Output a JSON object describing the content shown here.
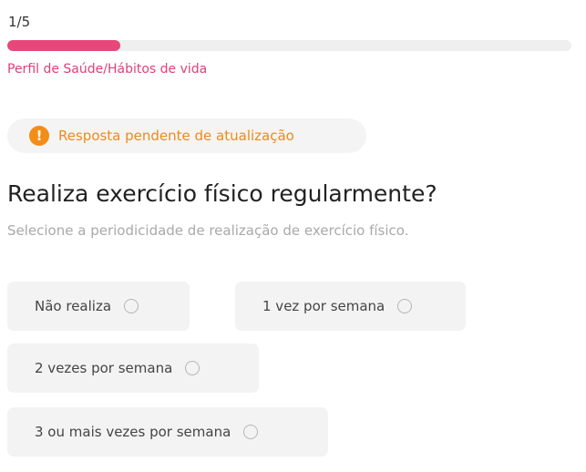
{
  "progress": {
    "counter": "1/5",
    "fraction": 0.2,
    "section": "Perfil de Saúde/Hábitos de vida",
    "fill_color": "#e7477a"
  },
  "status": {
    "icon": "warning-icon",
    "icon_glyph": "!",
    "text": "Resposta pendente de atualização",
    "color": "#ef8a17"
  },
  "question": {
    "title": "Realiza exercício físico regularmente?",
    "hint": "Selecione a periodicidade de realização de exercício físico."
  },
  "options": [
    {
      "label": "Não realiza",
      "selected": false
    },
    {
      "label": "1 vez por semana",
      "selected": false
    },
    {
      "label": "2 vezes por semana",
      "selected": false
    },
    {
      "label": "3 ou mais vezes por semana",
      "selected": false
    }
  ]
}
